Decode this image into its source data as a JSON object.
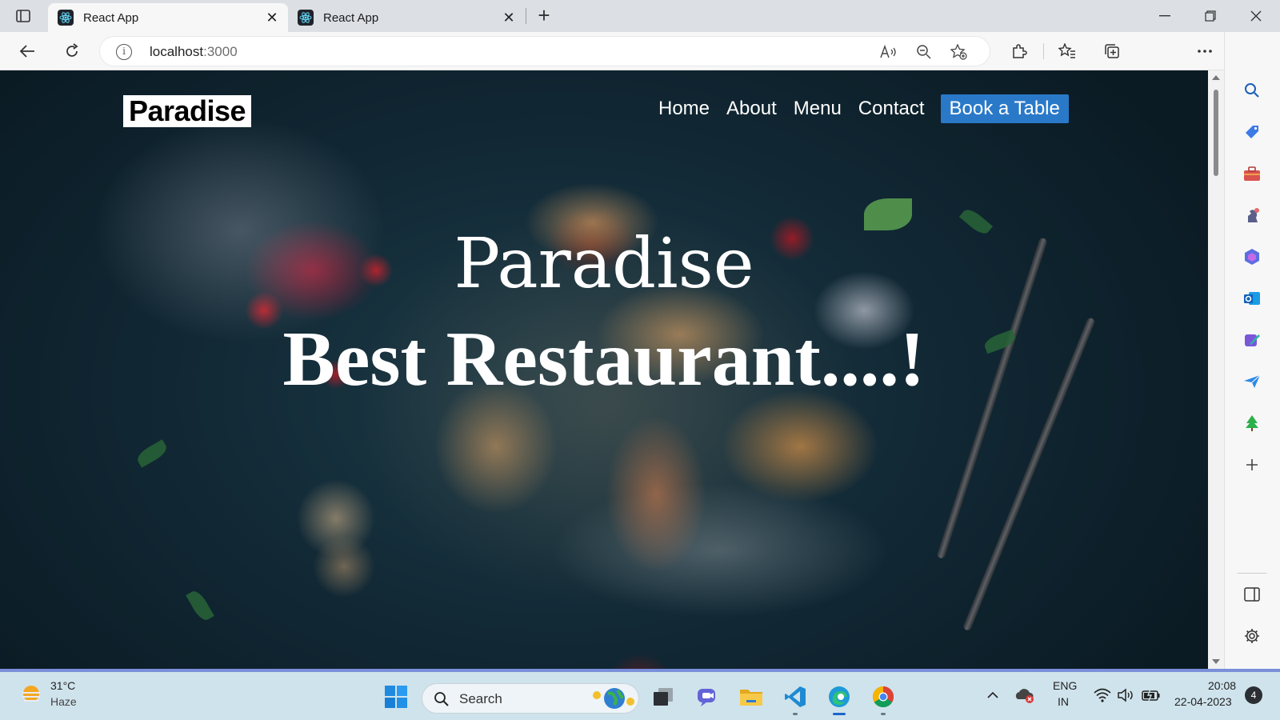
{
  "browser": {
    "tabs": [
      {
        "label": "React App",
        "active": true
      },
      {
        "label": "React App",
        "active": false
      }
    ],
    "address": {
      "host": "localhost",
      "port": ":3000"
    }
  },
  "site": {
    "logo": "Paradise",
    "nav": [
      "Home",
      "About",
      "Menu",
      "Contact"
    ],
    "cta": "Book a Table",
    "hero_line1": "Paradise",
    "hero_line2": "Best Restaurant....!"
  },
  "taskbar": {
    "weather_temp": "31°C",
    "weather_desc": "Haze",
    "search_placeholder": "Search",
    "lang_1": "ENG",
    "lang_2": "IN",
    "time": "20:08",
    "date": "22-04-2023",
    "notification_count": "4"
  },
  "colors": {
    "cta_blue": "#2a79c9",
    "taskbar_bg": "#cfe3ec",
    "hero_bg": "#102632"
  }
}
